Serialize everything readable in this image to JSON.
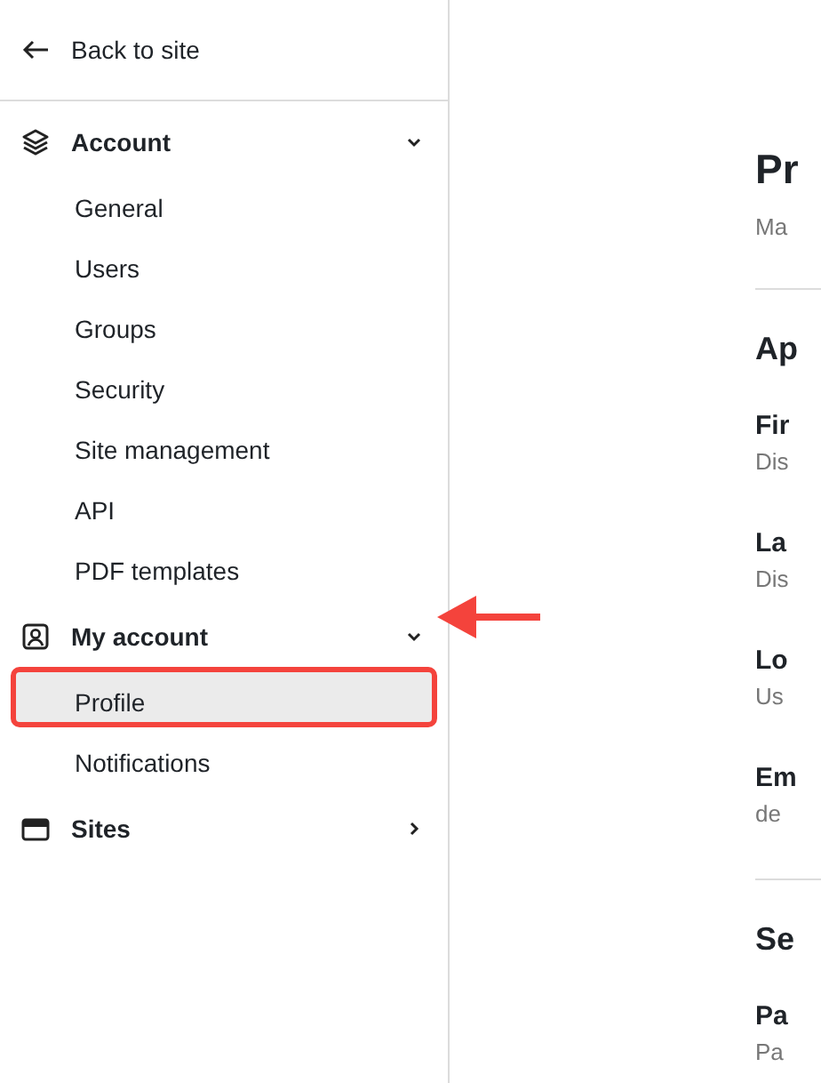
{
  "sidebar": {
    "back_link": "Back to site",
    "groups": [
      {
        "label": "Account",
        "expanded": true,
        "arrow": false,
        "items": [
          {
            "label": "General",
            "selected": false,
            "outlined": false
          },
          {
            "label": "Users",
            "selected": false,
            "outlined": false
          },
          {
            "label": "Groups",
            "selected": false,
            "outlined": false
          },
          {
            "label": "Security",
            "selected": false,
            "outlined": false
          },
          {
            "label": "Site management",
            "selected": false,
            "outlined": false
          },
          {
            "label": "API",
            "selected": false,
            "outlined": false
          },
          {
            "label": "PDF templates",
            "selected": false,
            "outlined": false
          }
        ]
      },
      {
        "label": "My account",
        "expanded": true,
        "arrow": true,
        "items": [
          {
            "label": "Profile",
            "selected": true,
            "outlined": true
          },
          {
            "label": "Notifications",
            "selected": false,
            "outlined": false
          }
        ]
      },
      {
        "label": "Sites",
        "expanded": false,
        "arrow": false
      }
    ]
  },
  "main": {
    "title": "Pr",
    "subtitle": "Ma",
    "sections": [
      {
        "heading": "Ap",
        "fields": [
          {
            "label": "Fir",
            "hint": "Dis"
          },
          {
            "label": "La",
            "hint": "Dis"
          },
          {
            "label": "Lo",
            "hint": "Us"
          },
          {
            "label": "Em",
            "hint": "de"
          }
        ]
      },
      {
        "heading": "Se",
        "fields": [
          {
            "label": "Pa",
            "hint": "Pa"
          }
        ]
      }
    ]
  }
}
